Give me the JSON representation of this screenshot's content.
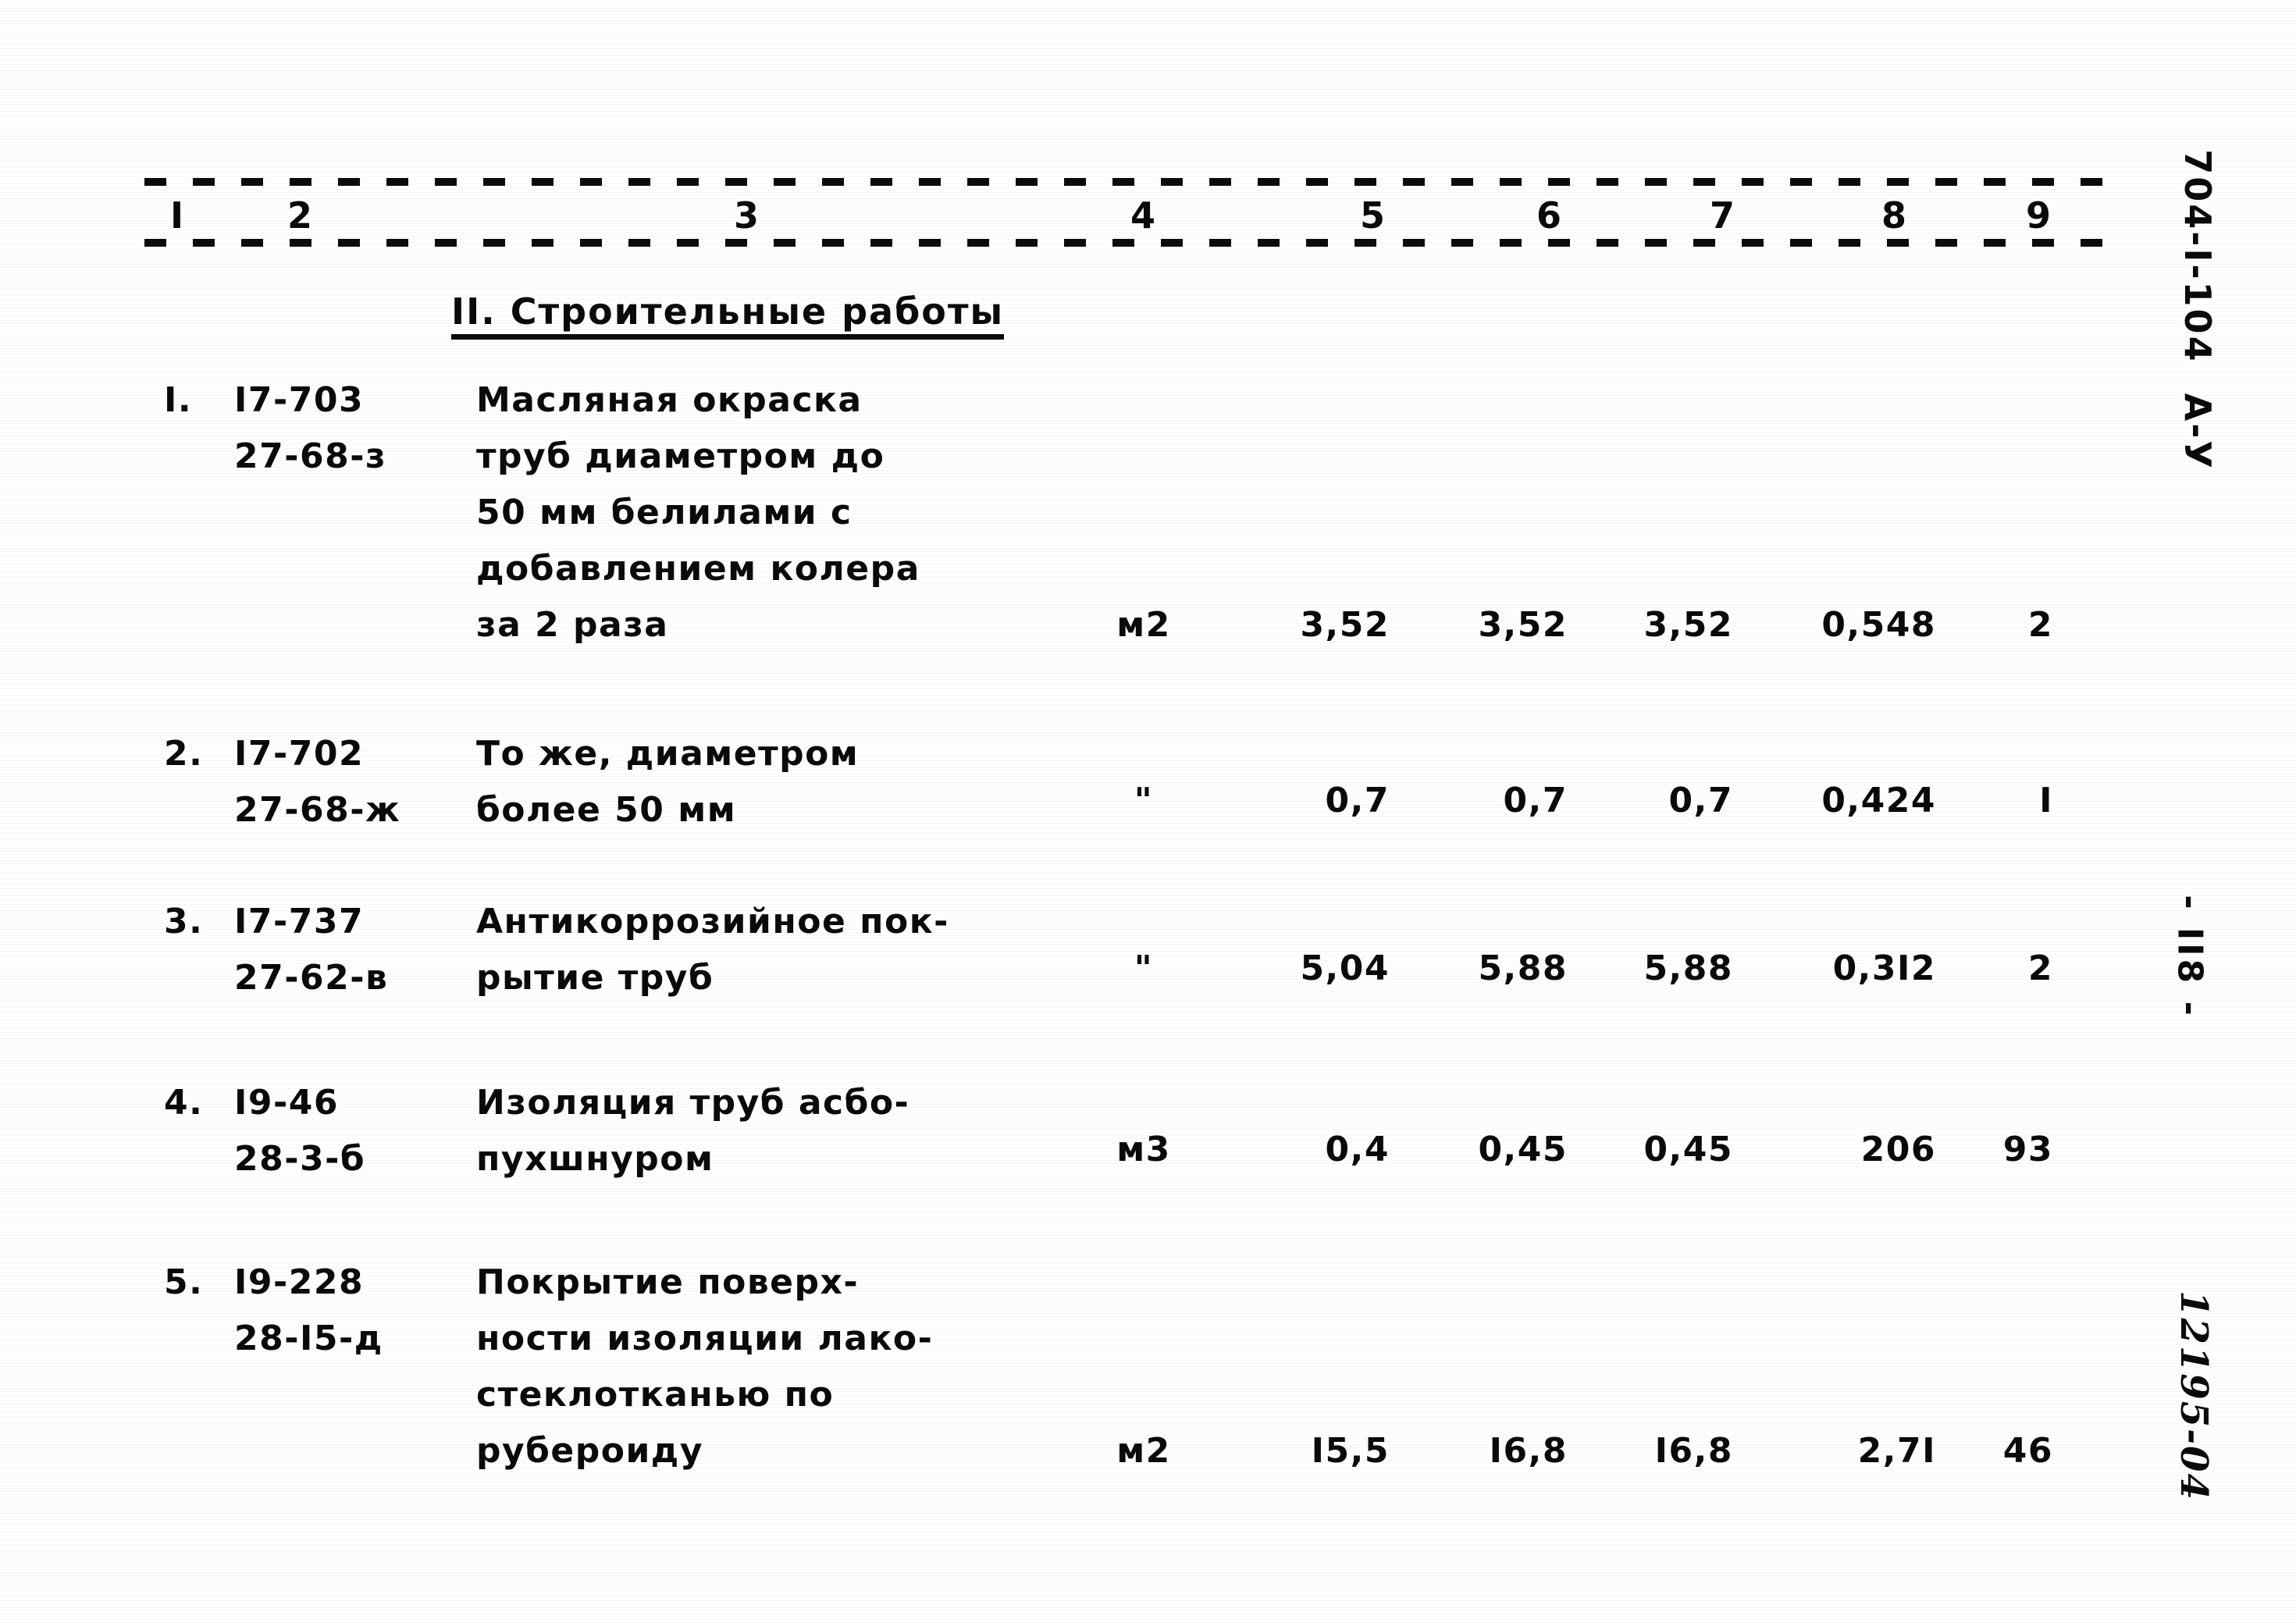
{
  "document": {
    "series_code": "704-I-104  А-У",
    "page_number": "- II8 -",
    "archive_stamp": "12195-04"
  },
  "table": {
    "column_numbers": [
      "I",
      "2",
      "3",
      "4",
      "5",
      "6",
      "7",
      "8",
      "9"
    ],
    "section_title": "II. Строительные работы",
    "rows": [
      {
        "index": "I.",
        "code_top": "I7-703",
        "code_bottom": "27-68-з",
        "description": [
          "Масляная окраска",
          "труб диаметром до",
          "50 мм белилами с",
          "добавлением колера",
          "за 2 раза"
        ],
        "unit": "м2",
        "col5": "3,52",
        "col6": "3,52",
        "col7": "3,52",
        "col8": "0,548",
        "col9": "2"
      },
      {
        "index": "2.",
        "code_top": "I7-702",
        "code_bottom": "27-68-ж",
        "description": [
          "То же, диаметром",
          "более 50 мм"
        ],
        "unit": "\"",
        "col5": "0,7",
        "col6": "0,7",
        "col7": "0,7",
        "col8": "0,424",
        "col9": "I"
      },
      {
        "index": "3.",
        "code_top": "I7-737",
        "code_bottom": "27-62-в",
        "description": [
          "Антикоррозийное пок-",
          "рытие труб"
        ],
        "unit": "\"",
        "col5": "5,04",
        "col6": "5,88",
        "col7": "5,88",
        "col8": "0,3I2",
        "col9": "2"
      },
      {
        "index": "4.",
        "code_top": "I9-46",
        "code_bottom": "28-3-б",
        "description": [
          "Изоляция труб асбо-",
          "пухшнуром"
        ],
        "unit": "м3",
        "col5": "0,4",
        "col6": "0,45",
        "col7": "0,45",
        "col8": "206",
        "col9": "93"
      },
      {
        "index": "5.",
        "code_top": "I9-228",
        "code_bottom": "28-I5-д",
        "description": [
          "Покрытие поверх-",
          "ности изоляции лако-",
          "стеклотканью по",
          "рубероиду"
        ],
        "unit": "м2",
        "col5": "I5,5",
        "col6": "I6,8",
        "col7": "I6,8",
        "col8": "2,7I",
        "col9": "46"
      }
    ]
  }
}
